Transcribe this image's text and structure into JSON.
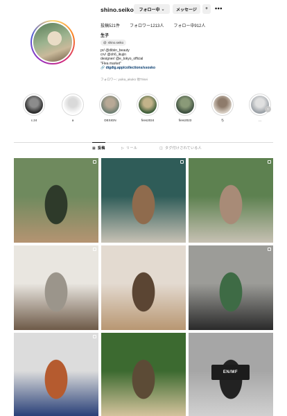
{
  "profile": {
    "username": "shino.seiko",
    "follow_label": "フォロー中",
    "message_label": "メッセージ",
    "add_label": "+凡",
    "more_label": "•••",
    "posts": "投稿521件",
    "followers": "フォロワー1213人",
    "following": "フォロー中912人",
    "full_name": "生子",
    "threads_label": "shino.seiko",
    "bio_lines": [
      "pr/ @dibiin_beauty",
      "crv/ @oh6_ikujin",
      "designer/ @e_tokyo_official",
      "\"Flea market\"",
      "🔗 digdig.app/collections/ssosko"
    ],
    "followed_by": "フォロワー: yuika_akuko 他Trisei"
  },
  "highlights": [
    {
      "label": "c.24",
      "colors": [
        "#2b2b2b",
        "#8c8c8c"
      ]
    },
    {
      "label": "a",
      "colors": [
        "#fafafa",
        "#d9d9d9"
      ]
    },
    {
      "label": "DESIGN",
      "colors": [
        "#6f7f73",
        "#b8a996"
      ]
    },
    {
      "label": "fires2024",
      "colors": [
        "#3f5e3a",
        "#c2b38a"
      ]
    },
    {
      "label": "fires2023",
      "colors": [
        "#3d4f3f",
        "#8a9a78"
      ]
    },
    {
      "label": "ち",
      "colors": [
        "#d8cfc4",
        "#8e7b6b"
      ]
    },
    {
      "label": "…",
      "colors": [
        "#9aa0a6",
        "#e0e0e0"
      ]
    }
  ],
  "tabs": [
    {
      "label": "投稿",
      "icon": "grid-icon",
      "active": true
    },
    {
      "label": "リール",
      "icon": "reels-icon",
      "active": false
    },
    {
      "label": "タグ付けされている人",
      "icon": "tagged-icon",
      "active": false
    }
  ],
  "posts": [
    {
      "desc": "woman with camera outdoors",
      "colors": [
        "#6f8a5e",
        "#b59472",
        "#2e3a2a"
      ],
      "multi": true
    },
    {
      "desc": "woman walking by wall",
      "colors": [
        "#2f5c58",
        "#c8c2b5",
        "#8f6b4d"
      ],
      "multi": true
    },
    {
      "desc": "woman cycling under trees",
      "colors": [
        "#5d8150",
        "#c7c1b3",
        "#a88b77"
      ],
      "multi": true
    },
    {
      "desc": "white samoyed dogs",
      "colors": [
        "#e9e6e0",
        "#6e5a48",
        "#9b958b"
      ],
      "multi": true
    },
    {
      "desc": "arched hallway",
      "colors": [
        "#e3dad0",
        "#b89772",
        "#5b4533"
      ],
      "multi": false
    },
    {
      "desc": "woman on street corner",
      "colors": [
        "#9c9c98",
        "#2a2a2a",
        "#3e6b45"
      ],
      "multi": true
    },
    {
      "desc": "room with wall art",
      "colors": [
        "#dcdcdc",
        "#233b75",
        "#b55b2f"
      ],
      "multi": true
    },
    {
      "desc": "blonde woman in garden",
      "colors": [
        "#3c6a30",
        "#d9c6a0",
        "#5c4b36"
      ],
      "multi": false
    },
    {
      "desc": "gray wall sign",
      "colors": [
        "#a6a6a6",
        "#d2d2d2",
        "#222222"
      ],
      "multi": false,
      "sign": "EN/MF"
    }
  ],
  "colors": {
    "link": "#00376b",
    "muted": "#8e8e8e",
    "border": "#dbdbdb",
    "button": "#efefef"
  }
}
